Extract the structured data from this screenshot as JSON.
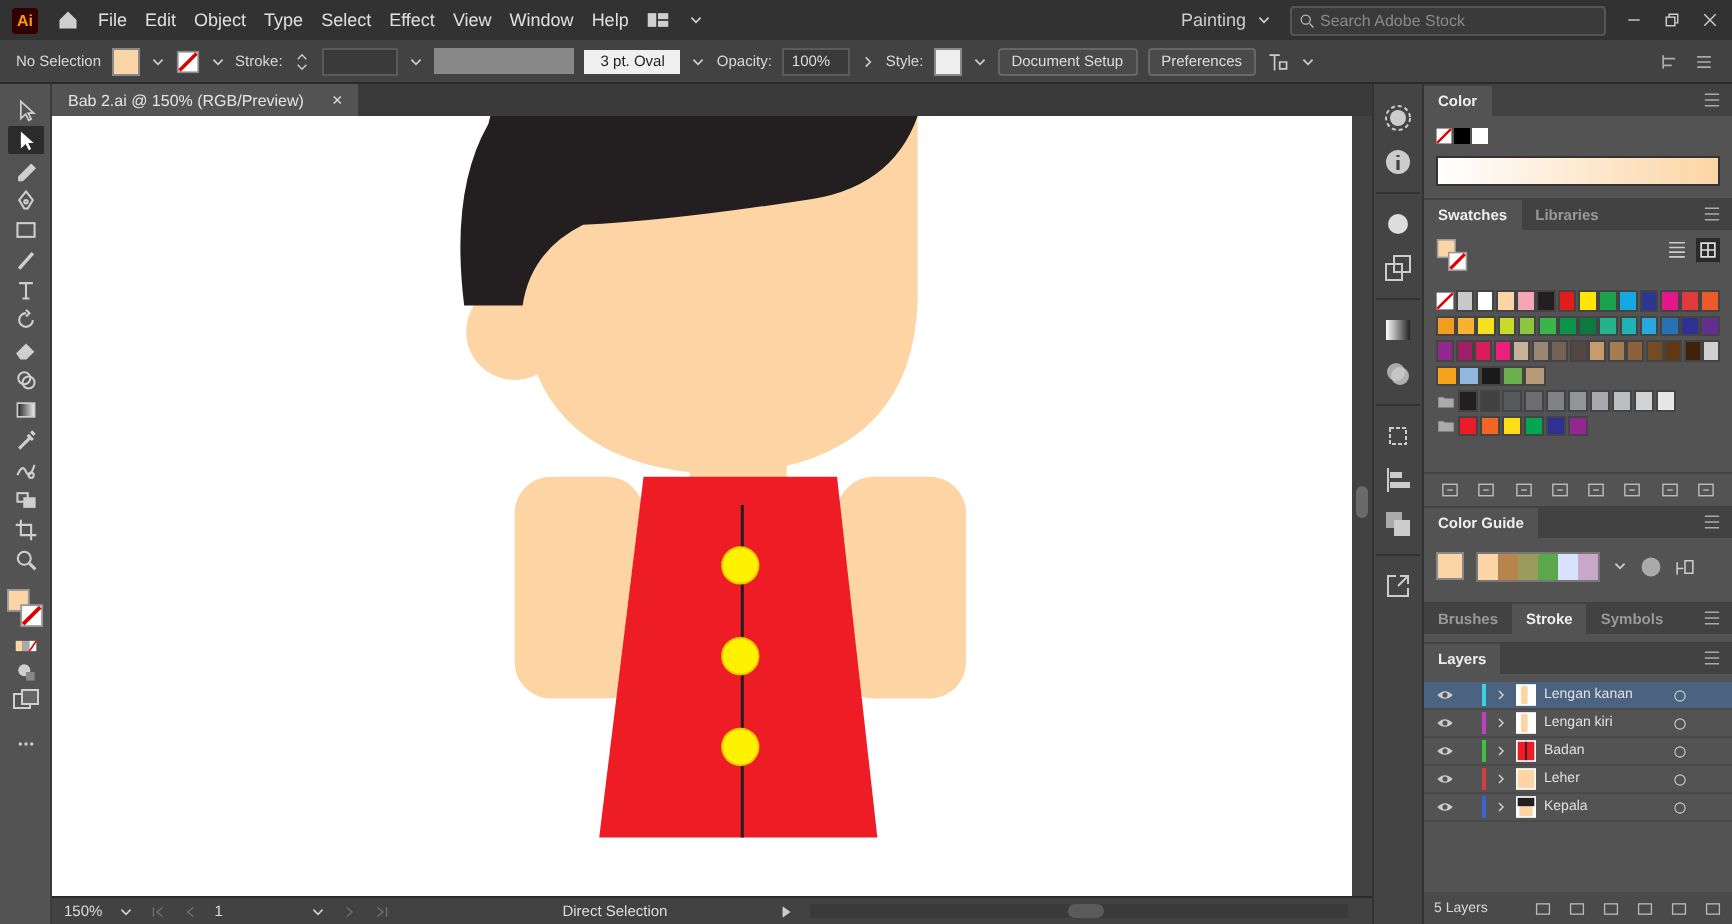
{
  "app": {
    "logo": "Ai",
    "menu": [
      "File",
      "Edit",
      "Object",
      "Type",
      "Select",
      "Effect",
      "View",
      "Window",
      "Help"
    ],
    "workspace": "Painting",
    "search": {
      "placeholder": "Search Adobe Stock"
    }
  },
  "control_bar": {
    "selection": "No Selection",
    "stroke_label": "Stroke:",
    "brush": "3 pt. Oval",
    "opacity_label": "Opacity:",
    "opacity": "100%",
    "style_label": "Style:",
    "buttons": [
      "Document Setup",
      "Preferences"
    ]
  },
  "document_tab": {
    "title": "Bab 2.ai @ 150% (RGB/Preview)",
    "close": "×"
  },
  "tools": [
    {
      "kind": "selection",
      "selected": false
    },
    {
      "kind": "direct",
      "selected": true
    },
    {
      "kind": "pencil",
      "selected": false
    },
    {
      "kind": "pen",
      "selected": false
    },
    {
      "kind": "rectangle",
      "selected": false
    },
    {
      "kind": "brush",
      "selected": false
    },
    {
      "kind": "type",
      "selected": false
    },
    {
      "kind": "rotate",
      "selected": false
    },
    {
      "kind": "eraser",
      "selected": false
    },
    {
      "kind": "shapebuilder",
      "selected": false
    },
    {
      "kind": "gradient",
      "selected": false
    },
    {
      "kind": "eyedropper",
      "selected": false
    },
    {
      "kind": "warp",
      "selected": false
    },
    {
      "kind": "livepaint",
      "selected": false
    },
    {
      "kind": "artboard",
      "selected": false
    },
    {
      "kind": "zoom",
      "selected": false
    }
  ],
  "status_bar": {
    "zoom": "150%",
    "page": "1",
    "tool": "Direct Selection"
  },
  "color_panel": {
    "tab": "Color"
  },
  "swatches_panel": {
    "tabs": [
      {
        "label": "Swatches",
        "selected": true
      },
      {
        "label": "Libraries",
        "selected": false
      }
    ],
    "rows": [
      {
        "swatches": [
          {
            "kind": "none"
          },
          {
            "color": "#c8c8c8"
          },
          {
            "color": "#ffffff"
          },
          {
            "color": "#fcd5a6"
          },
          {
            "color": "#f4a6b6"
          },
          {
            "color": "#231f20"
          },
          {
            "color": "#e21b1b"
          },
          {
            "color": "#ffe600"
          },
          {
            "color": "#1aa34a"
          },
          {
            "color": "#14a9e0"
          },
          {
            "color": "#2d3691"
          },
          {
            "color": "#e3168c"
          },
          {
            "color": "#e03a3e"
          },
          {
            "color": "#ed5a2a"
          }
        ]
      },
      {
        "swatches": [
          {
            "color": "#f39c1f"
          },
          {
            "color": "#f7b233"
          },
          {
            "color": "#f7e11e"
          },
          {
            "color": "#c9db2a"
          },
          {
            "color": "#8dc63f"
          },
          {
            "color": "#3ab54a"
          },
          {
            "color": "#0a9449"
          },
          {
            "color": "#0b7a3e"
          },
          {
            "color": "#25b38b"
          },
          {
            "color": "#1fb2b7"
          },
          {
            "color": "#29a7df"
          },
          {
            "color": "#2771b7"
          },
          {
            "color": "#2e3192"
          },
          {
            "color": "#662d91"
          }
        ]
      },
      {
        "swatches": [
          {
            "color": "#92278f"
          },
          {
            "color": "#9e1f63"
          },
          {
            "color": "#d91c5c"
          },
          {
            "color": "#ec1f7b"
          },
          {
            "color": "#c7b299"
          },
          {
            "color": "#998675"
          },
          {
            "color": "#736357"
          },
          {
            "color": "#534741"
          },
          {
            "color": "#c69c6d"
          },
          {
            "color": "#a67c52"
          },
          {
            "color": "#8c6239"
          },
          {
            "color": "#754c24"
          },
          {
            "color": "#603813"
          },
          {
            "color": "#42210b"
          },
          {
            "color": "#d0d0d0"
          }
        ]
      },
      {
        "swatches": [
          {
            "color": "#f7a21b"
          },
          {
            "color": "#8fb7e0"
          },
          {
            "color": "#1a1a1a"
          },
          {
            "color": "#6ab04c"
          },
          {
            "color": "#b89a78"
          }
        ]
      }
    ],
    "groups": [
      {
        "swatches": [
          {
            "color": "#231f20"
          },
          {
            "color": "#414042"
          },
          {
            "color": "#58595b"
          },
          {
            "color": "#6d6e71"
          },
          {
            "color": "#808285"
          },
          {
            "color": "#939598"
          },
          {
            "color": "#a7a9ac"
          },
          {
            "color": "#bcbec0"
          },
          {
            "color": "#d1d3d4"
          },
          {
            "color": "#e6e7e8"
          }
        ]
      },
      {
        "swatches": [
          {
            "color": "#ed1c24"
          },
          {
            "color": "#f26522"
          },
          {
            "color": "#ffde17"
          },
          {
            "color": "#00a651"
          },
          {
            "color": "#2e3192"
          },
          {
            "color": "#92278f"
          }
        ]
      }
    ]
  },
  "color_guide": {
    "tab": "Color Guide",
    "harmony": [
      {
        "color": "#fcd5a6"
      },
      {
        "color": "#b8844e"
      },
      {
        "color": "#9a9a5a"
      },
      {
        "color": "#5aa84a"
      },
      {
        "color": "#d8e2ff"
      },
      {
        "color": "#c8a8c8"
      }
    ]
  },
  "stroke_tabs": [
    {
      "label": "Brushes",
      "selected": false
    },
    {
      "label": "Stroke",
      "selected": true
    },
    {
      "label": "Symbols",
      "selected": false
    }
  ],
  "layers": {
    "tab": "Layers",
    "items": [
      {
        "name": "Lengan kanan",
        "color": "#3fd0e0",
        "selected": true
      },
      {
        "name": "Lengan kiri",
        "color": "#c040c0",
        "selected": false
      },
      {
        "name": "Badan",
        "color": "#40c040",
        "selected": false
      },
      {
        "name": "Leher",
        "color": "#d04040",
        "selected": false
      },
      {
        "name": "Kepala",
        "color": "#4060d0",
        "selected": false
      }
    ],
    "count": "5 Layers"
  }
}
